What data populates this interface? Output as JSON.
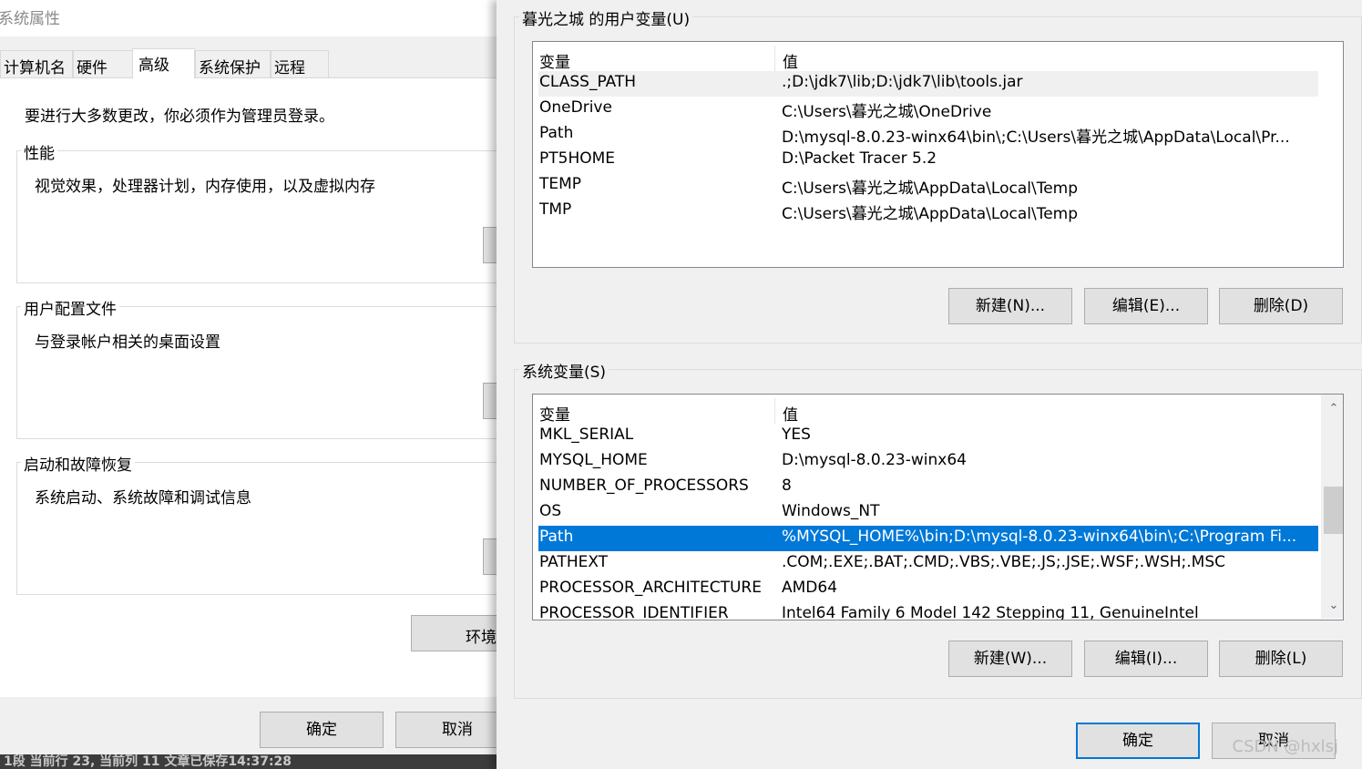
{
  "left_dialog": {
    "title": "系统属性",
    "tabs": [
      "计算机名",
      "硬件",
      "高级",
      "系统保护",
      "远程"
    ],
    "active_tab": "高级",
    "admin_notice": "要进行大多数更改，你必须作为管理员登录。",
    "performance": {
      "title": "性能",
      "description": "视觉效果，处理器计划，内存使用，以及虚拟内存"
    },
    "user_profiles": {
      "title": "用户配置文件",
      "description": "与登录帐户相关的桌面设置"
    },
    "startup_recovery": {
      "title": "启动和故障恢复",
      "description": "系统启动、系统故障和调试信息"
    },
    "env_button_label": "环境",
    "ok_label": "确定",
    "cancel_label": "取消",
    "status_bar_text": "1段  当前行 23, 当前列 11  文章已保存14:37:28"
  },
  "right_dialog": {
    "user_vars": {
      "title": "暮光之城 的用户变量(U)",
      "columns": [
        "变量",
        "值"
      ],
      "rows": [
        {
          "name": "CLASS_PATH",
          "value": ".;D:\\jdk7\\lib;D:\\jdk7\\lib\\tools.jar"
        },
        {
          "name": "OneDrive",
          "value": "C:\\Users\\暮光之城\\OneDrive"
        },
        {
          "name": "Path",
          "value": "D:\\mysql-8.0.23-winx64\\bin\\;C:\\Users\\暮光之城\\AppData\\Local\\Pr..."
        },
        {
          "name": "PT5HOME",
          "value": "D:\\Packet Tracer 5.2"
        },
        {
          "name": "TEMP",
          "value": "C:\\Users\\暮光之城\\AppData\\Local\\Temp"
        },
        {
          "name": "TMP",
          "value": "C:\\Users\\暮光之城\\AppData\\Local\\Temp"
        }
      ],
      "hover_row": "CLASS_PATH",
      "buttons": {
        "new": "新建(N)...",
        "edit": "编辑(E)...",
        "delete": "删除(D)"
      }
    },
    "system_vars": {
      "title": "系统变量(S)",
      "columns": [
        "变量",
        "值"
      ],
      "rows": [
        {
          "name": "MKL_SERIAL",
          "value": "YES"
        },
        {
          "name": "MYSQL_HOME",
          "value": "D:\\mysql-8.0.23-winx64"
        },
        {
          "name": "NUMBER_OF_PROCESSORS",
          "value": "8"
        },
        {
          "name": "OS",
          "value": "Windows_NT"
        },
        {
          "name": "Path",
          "value": "%MYSQL_HOME%\\bin;D:\\mysql-8.0.23-winx64\\bin\\;C:\\Program Fi..."
        },
        {
          "name": "PATHEXT",
          "value": ".COM;.EXE;.BAT;.CMD;.VBS;.VBE;.JS;.JSE;.WSF;.WSH;.MSC"
        },
        {
          "name": "PROCESSOR_ARCHITECTURE",
          "value": "AMD64"
        },
        {
          "name": "PROCESSOR_IDENTIFIER",
          "value": "Intel64 Family 6 Model 142 Stepping 11, GenuineIntel"
        }
      ],
      "selected_row": "Path",
      "buttons": {
        "new": "新建(W)...",
        "edit": "编辑(I)...",
        "delete": "删除(L)"
      }
    },
    "ok_label": "确定",
    "cancel_label": "取消"
  },
  "watermark": "CSDN @hxlsj",
  "colors": {
    "selection": "#0078d7",
    "dialog_bg": "#f0f0f0",
    "button_bg": "#e1e1e1"
  }
}
